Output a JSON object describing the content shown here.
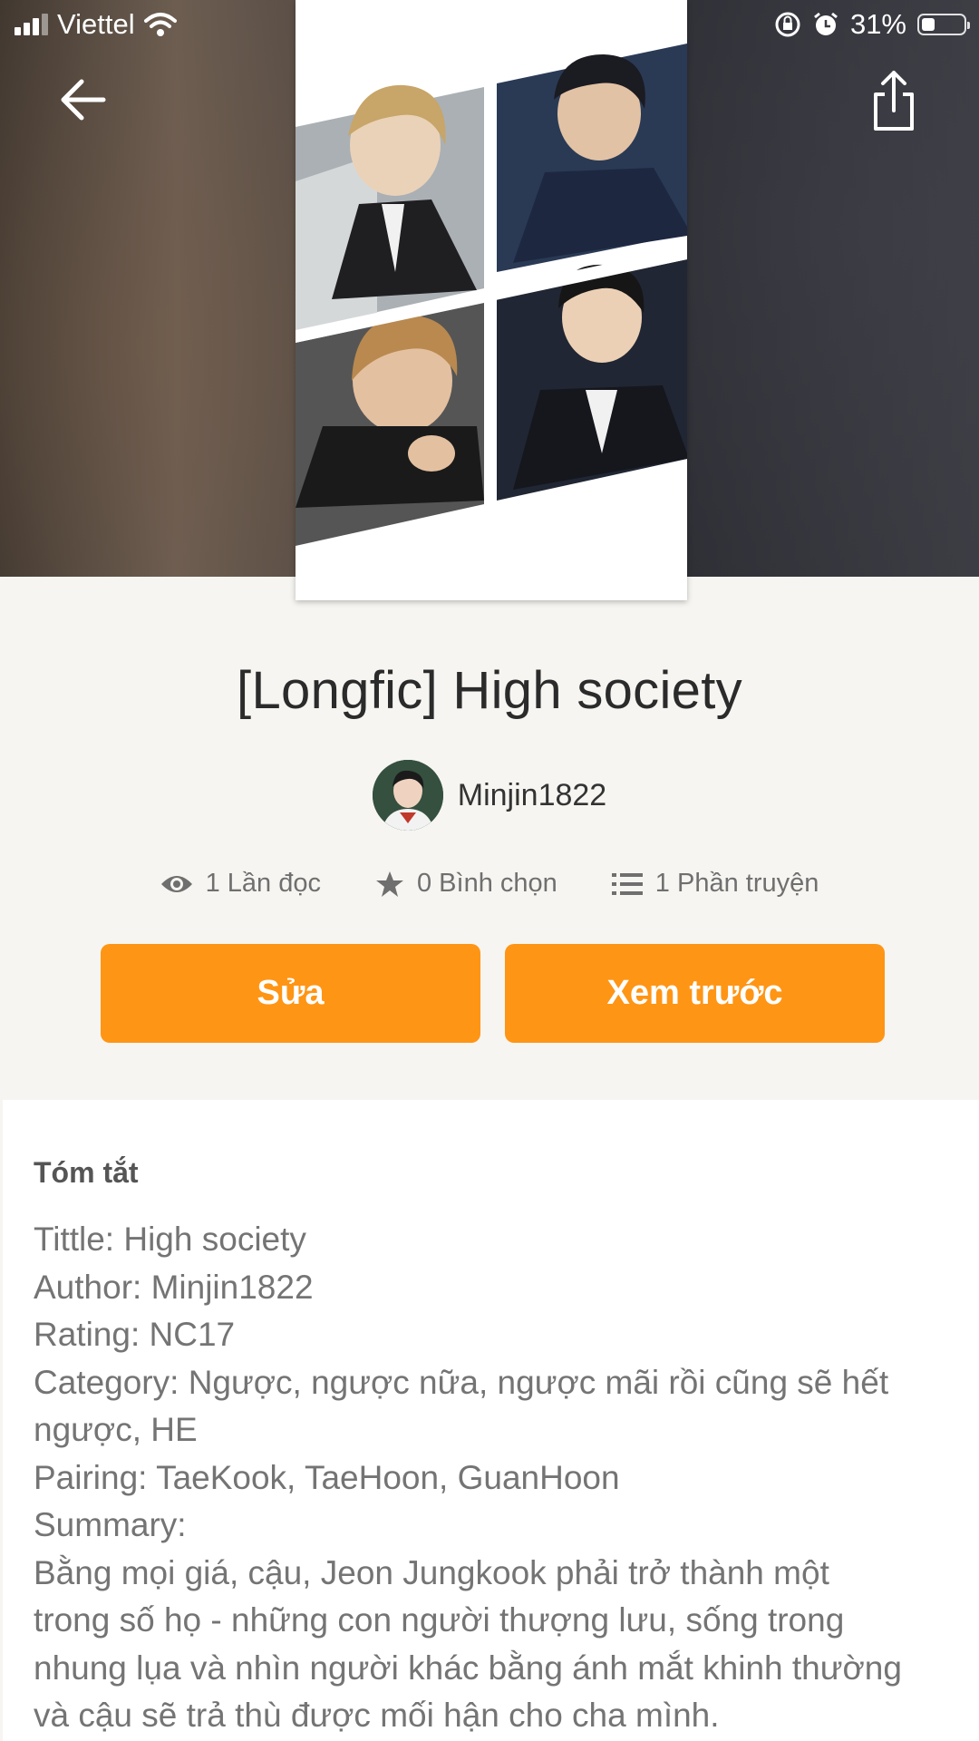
{
  "status_bar": {
    "carrier": "Viettel",
    "battery_percent": "31%",
    "battery_level": 0.31
  },
  "nav": {
    "back_icon": "arrow-left-icon",
    "share_icon": "share-icon"
  },
  "story": {
    "title": "[Longfic] High society",
    "author": "Minjin1822",
    "stats": {
      "reads": "1 Lần đọc",
      "votes": "0 Bình chọn",
      "parts": "1 Phần truyện"
    }
  },
  "actions": {
    "edit_label": "Sửa",
    "preview_label": "Xem trước"
  },
  "summary": {
    "heading": "Tóm tắt",
    "lines": [
      "Tittle: High society",
      "Author: Minjin1822",
      "Rating: NC17",
      "Category:  Ngược, ngược nữa, ngược mãi rồi cũng sẽ hết",
      "ngược, HE",
      "Pairing: TaeKook, TaeHoon, GuanHoon",
      "Summary:",
      "Bằng mọi giá, cậu, Jeon Jungkook phải trở thành một",
      "trong số họ - những con người thượng lưu, sống trong",
      "nhung lụa và nhìn người khác bằng ánh mắt khinh thường",
      "và cậu sẽ trả thù được mối hận cho cha mình."
    ]
  },
  "colors": {
    "accent": "#ff9514",
    "background": "#f6f5f1",
    "card": "#ffffff"
  }
}
